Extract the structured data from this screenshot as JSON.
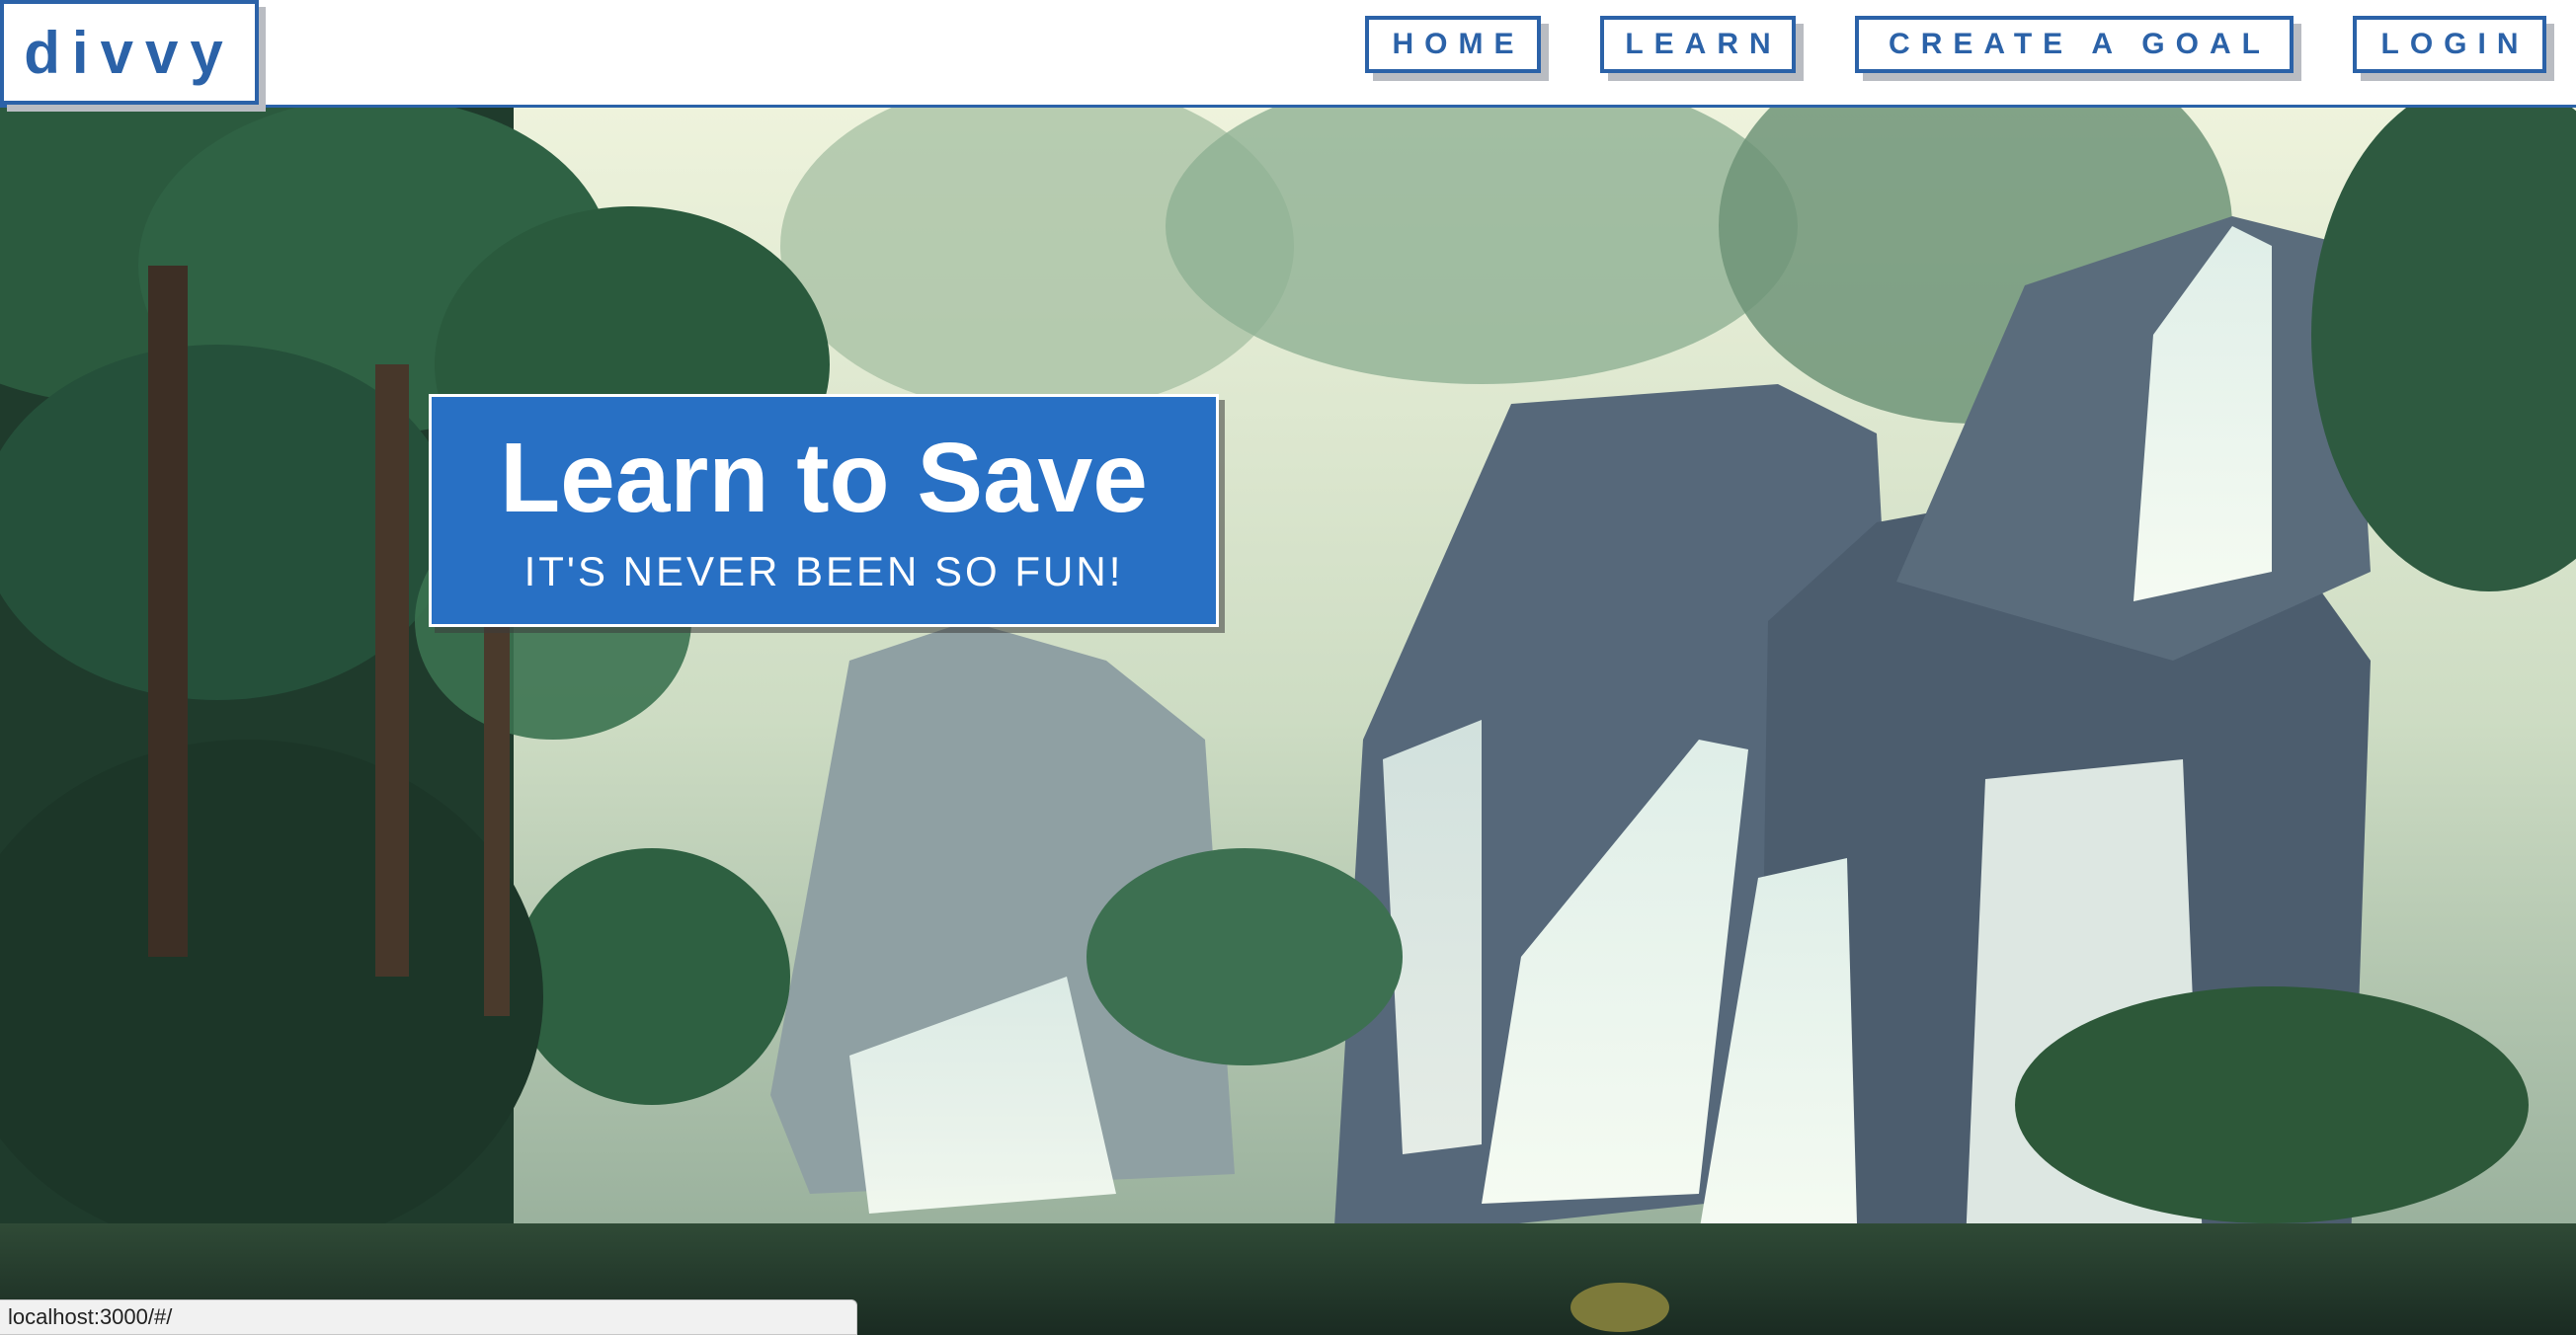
{
  "navbar": {
    "logo": "divvy",
    "links": {
      "home": "HOME",
      "learn": "LEARN",
      "create_goal": "CREATE A GOAL",
      "login": "LOGIN"
    }
  },
  "hero": {
    "title": "Learn to Save",
    "subtitle": "IT'S NEVER BEEN SO FUN!",
    "background": "pixel-art-forest-waterfall-image"
  },
  "status_bar": {
    "url": "localhost:3000/#/"
  },
  "colors": {
    "brand_blue": "#2b62a8",
    "card_blue": "#2870c4",
    "shadow_gray": "#b9bcc2"
  }
}
